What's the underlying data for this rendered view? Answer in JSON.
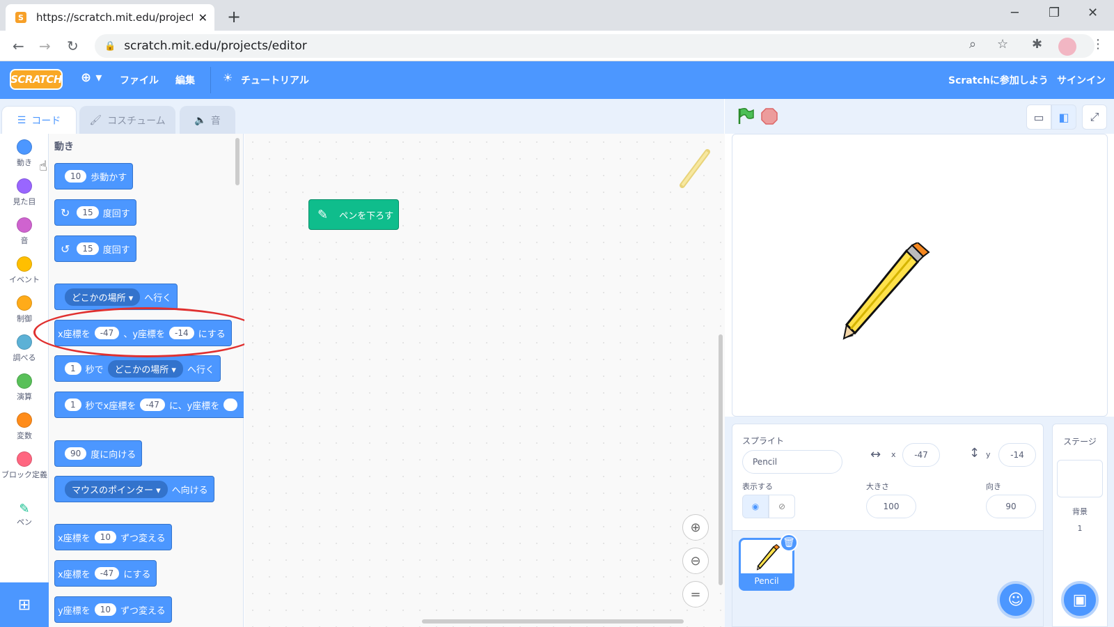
{
  "browser": {
    "tab_title": "https://scratch.mit.edu/projects/e",
    "tab_close": "✕",
    "new_tab": "+",
    "url": "scratch.mit.edu/projects/editor"
  },
  "menu": {
    "logo": "SCRATCH",
    "file": "ファイル",
    "edit": "編集",
    "tutorial": "チュートリアル",
    "join": "Scratchに参加しよう",
    "signin": "サインイン"
  },
  "tabs": {
    "code": "コード",
    "costume": "コスチューム",
    "sound": "音"
  },
  "categories": [
    {
      "label": "動き",
      "color": "#4c97ff"
    },
    {
      "label": "見た目",
      "color": "#9966ff"
    },
    {
      "label": "音",
      "color": "#cf63cf"
    },
    {
      "label": "イベント",
      "color": "#ffbf00"
    },
    {
      "label": "制御",
      "color": "#ffab19"
    },
    {
      "label": "調べる",
      "color": "#5cb1d6"
    },
    {
      "label": "演算",
      "color": "#59c059"
    },
    {
      "label": "変数",
      "color": "#ff8c1a"
    },
    {
      "label": "ブロック定義",
      "color": "#ff6680"
    },
    {
      "label": "ペン",
      "color": "#0fbd8c"
    }
  ],
  "palette": {
    "title": "動き",
    "move_val": "10",
    "move_label": "歩動かす",
    "turn_r_val": "15",
    "turn_r_label": "度回す",
    "turn_l_val": "15",
    "turn_l_label": "度回す",
    "goto_dd": "どこかの場所 ▾",
    "goto_label": "へ行く",
    "setxy_x_label": "x座標を",
    "setxy_x": "-47",
    "setxy_y_label": "、y座標を",
    "setxy_y": "-14",
    "setxy_end": "にする",
    "glide_sec": "1",
    "glide_label": "秒で",
    "glide_dd": "どこかの場所 ▾",
    "glide_end": "へ行く",
    "glidexy_sec": "1",
    "glidexy_label": "秒でx座標を",
    "glidexy_x": "-47",
    "glidexy_y_label": "に、y座標を",
    "point_val": "90",
    "point_label": "度に向ける",
    "towards_dd": "マウスのポインター ▾",
    "towards_label": "へ向ける",
    "changex_label": "x座標を",
    "changex_val": "10",
    "changex_end": "ずつ変える",
    "setx_label": "x座標を",
    "setx_val": "-47",
    "setx_end": "にする",
    "changey_label": "y座標を",
    "changey_val": "10",
    "changey_end": "ずつ変える"
  },
  "code_area": {
    "pen_down": "ペンを下ろす"
  },
  "sprite_info": {
    "sprite_label": "スプライト",
    "name": "Pencil",
    "x_label": "x",
    "x_val": "-47",
    "y_label": "y",
    "y_val": "-14",
    "show_label": "表示する",
    "size_label": "大きさ",
    "size_val": "100",
    "dir_label": "向き",
    "dir_val": "90"
  },
  "sprite_list": {
    "thumb_name": "Pencil"
  },
  "stage_pane": {
    "title": "ステージ",
    "backdrop_label": "背景",
    "backdrop_count": "1"
  }
}
